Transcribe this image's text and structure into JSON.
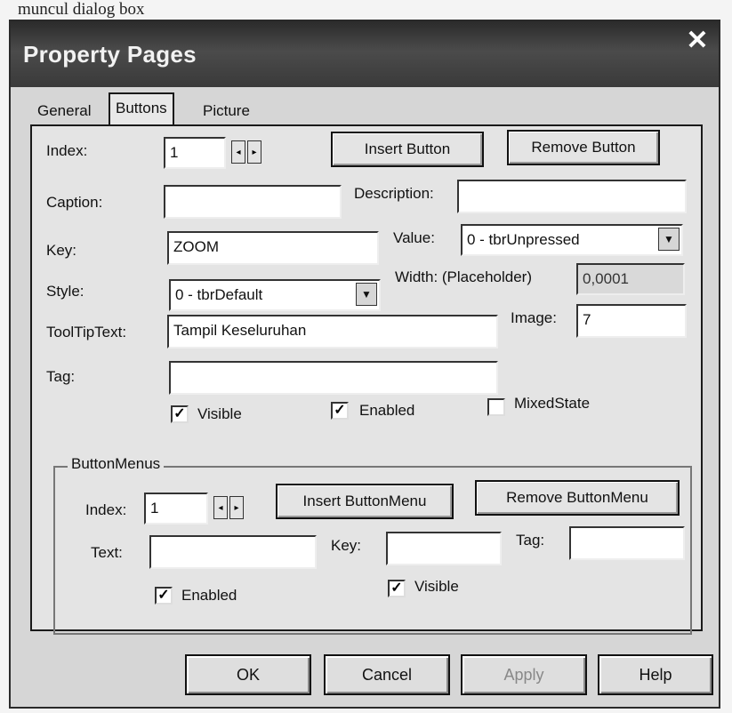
{
  "page_snippet": "muncul dialog box",
  "window": {
    "title": "Property Pages",
    "close_glyph": "✕"
  },
  "tabs": [
    {
      "label": "General"
    },
    {
      "label": "Buttons"
    },
    {
      "label": "Picture"
    }
  ],
  "buttons_tab": {
    "index_label": "Index:",
    "index_value": "1",
    "insert_button_label": "Insert Button",
    "remove_button_label": "Remove Button",
    "caption_label": "Caption:",
    "caption_value": "",
    "description_label": "Description:",
    "description_value": "",
    "key_label": "Key:",
    "key_value": "ZOOM",
    "value_label": "Value:",
    "value_value": "0 - tbrUnpressed",
    "style_label": "Style:",
    "style_value": "0 - tbrDefault",
    "width_label": "Width: (Placeholder)",
    "width_value": "0,0001",
    "tooltip_label": "ToolTipText:",
    "tooltip_value": "Tampil Keseluruhan",
    "image_label": "Image:",
    "image_value": "7",
    "tag_label": "Tag:",
    "tag_value": "",
    "visible_label": "Visible",
    "enabled_label": "Enabled",
    "mixedstate_label": "MixedState",
    "checks": {
      "visible": "✓",
      "enabled": "✓",
      "mixedstate": ""
    }
  },
  "button_menus": {
    "group_title": "ButtonMenus",
    "index_label": "Index:",
    "index_value": "1",
    "insert_label": "Insert ButtonMenu",
    "remove_label": "Remove ButtonMenu",
    "text_label": "Text:",
    "text_value": "",
    "key_label": "Key:",
    "key_value": "",
    "tag_label": "Tag:",
    "tag_value": "",
    "enabled_label": "Enabled",
    "visible_label": "Visible",
    "checks": {
      "enabled": "✓",
      "visible": "✓"
    }
  },
  "footer": {
    "ok": "OK",
    "cancel": "Cancel",
    "apply": "Apply",
    "help": "Help"
  },
  "icons": {
    "spin_left": "◂",
    "spin_right": "▸",
    "dropdown": "▼"
  }
}
